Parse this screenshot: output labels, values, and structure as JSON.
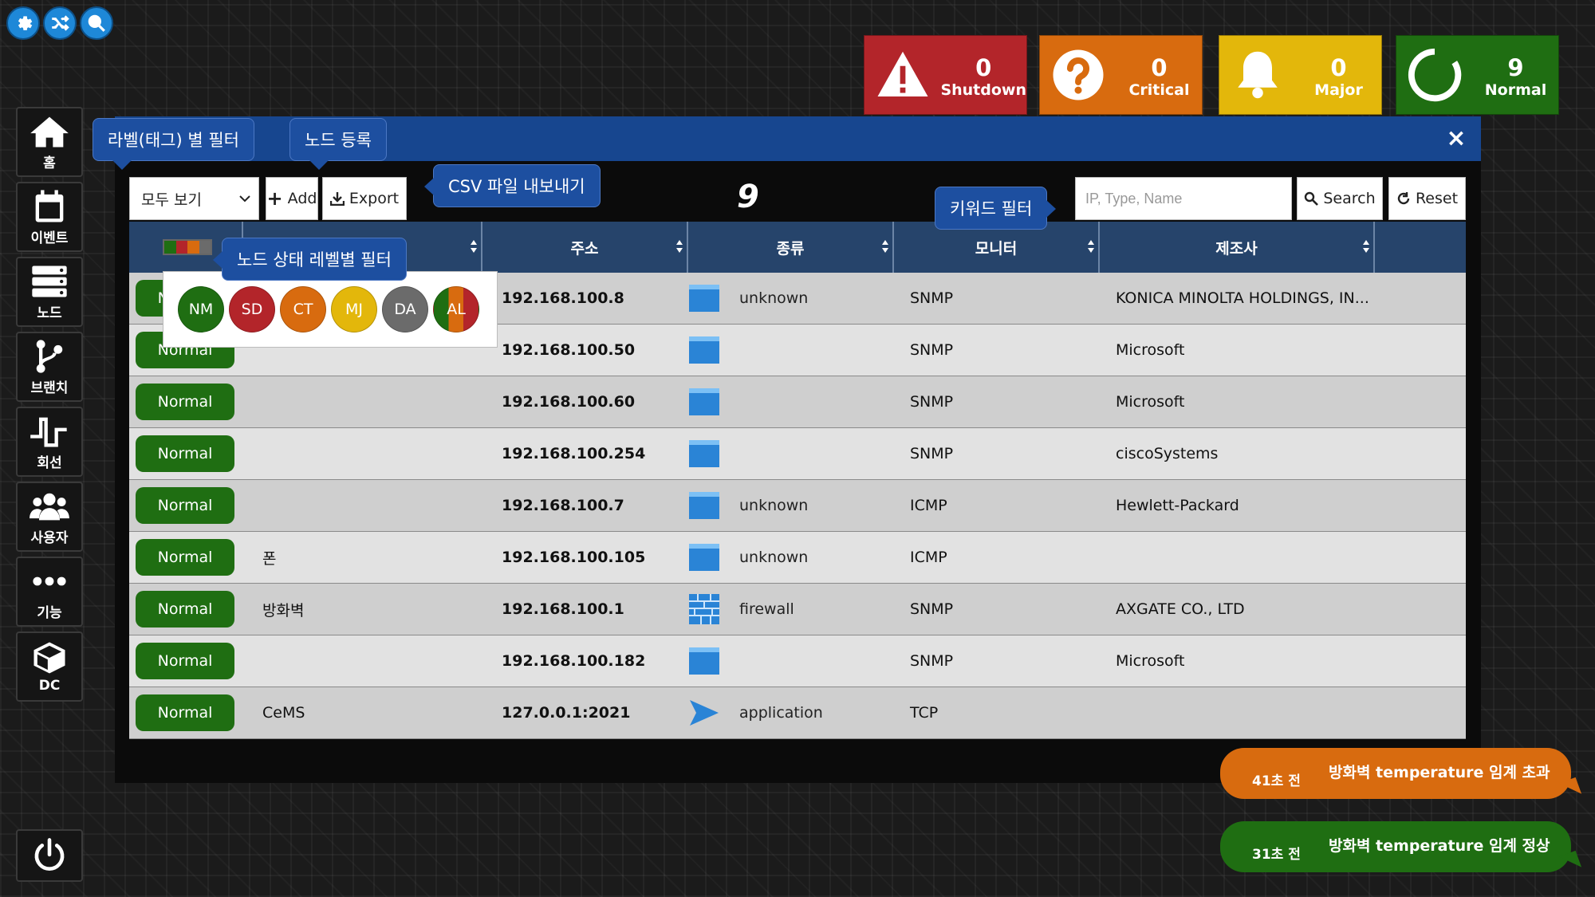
{
  "status_cards": [
    {
      "count": "0",
      "label": "Shutdown",
      "color": "#b3252a",
      "icon": "warning-icon"
    },
    {
      "count": "0",
      "label": "Critical",
      "color": "#d86b0f",
      "icon": "question-icon"
    },
    {
      "count": "0",
      "label": "Major",
      "color": "#e3b70b",
      "icon": "bell-icon"
    },
    {
      "count": "9",
      "label": "Normal",
      "color": "#1f6e12",
      "icon": "ring-icon"
    }
  ],
  "sidebar": {
    "items": [
      {
        "label": "홈"
      },
      {
        "label": "이벤트"
      },
      {
        "label": "노드"
      },
      {
        "label": "브랜치"
      },
      {
        "label": "회선"
      },
      {
        "label": "사용자"
      },
      {
        "label": "기능"
      },
      {
        "label": "DC"
      }
    ]
  },
  "toolbar": {
    "filter_selected": "모두 보기",
    "add_label": "Add",
    "export_label": "Export",
    "node_count": "9",
    "search_placeholder": "IP, Type, Name",
    "search_label": "Search",
    "reset_label": "Reset"
  },
  "tooltips": {
    "label_filter": "라벨(태그) 별 필터",
    "node_register": "노드 등록",
    "csv_export": "CSV 파일 내보내기",
    "keyword_filter": "키워드 필터",
    "status_level_filter": "노드 상태 레벨별 필터"
  },
  "table": {
    "headers": [
      "주소",
      "종류",
      "모니터",
      "제조사"
    ],
    "rows": [
      {
        "status": "Normal",
        "name": "",
        "address": "192.168.100.8",
        "type": "unknown",
        "monitor": "SNMP",
        "vendor": "KONICA MINOLTA HOLDINGS, IN..."
      },
      {
        "status": "Normal",
        "name": "",
        "address": "192.168.100.50",
        "type": "",
        "monitor": "SNMP",
        "vendor": "Microsoft"
      },
      {
        "status": "Normal",
        "name": "",
        "address": "192.168.100.60",
        "type": "",
        "monitor": "SNMP",
        "vendor": "Microsoft"
      },
      {
        "status": "Normal",
        "name": "",
        "address": "192.168.100.254",
        "type": "",
        "monitor": "SNMP",
        "vendor": "ciscoSystems"
      },
      {
        "status": "Normal",
        "name": "",
        "address": "192.168.100.7",
        "type": "unknown",
        "monitor": "ICMP",
        "vendor": "Hewlett-Packard"
      },
      {
        "status": "Normal",
        "name": "폰",
        "address": "192.168.100.105",
        "type": "unknown",
        "monitor": "ICMP",
        "vendor": ""
      },
      {
        "status": "Normal",
        "name": "방화벽",
        "address": "192.168.100.1",
        "type": "firewall",
        "monitor": "SNMP",
        "vendor": "AXGATE CO., LTD"
      },
      {
        "status": "Normal",
        "name": "",
        "address": "192.168.100.182",
        "type": "",
        "monitor": "SNMP",
        "vendor": "Microsoft"
      },
      {
        "status": "Normal",
        "name": "CeMS",
        "address": "127.0.0.1:2021",
        "type": "application",
        "monitor": "TCP",
        "vendor": ""
      }
    ]
  },
  "level_filter": [
    {
      "code": "NM",
      "color": "#1f6e12"
    },
    {
      "code": "SD",
      "color": "#b3252a"
    },
    {
      "code": "CT",
      "color": "#d86b0f"
    },
    {
      "code": "MJ",
      "color": "#e3b70b"
    },
    {
      "code": "DA",
      "color": "#6b6b6b"
    },
    {
      "code": "AL",
      "color": "#d86b0f"
    }
  ],
  "notifications": [
    {
      "time": "41초 전",
      "message": "방화벽 temperature 임계 초과",
      "color": "#d86b0f"
    },
    {
      "time": "31초 전",
      "message": "방화벽 temperature 임계 정상",
      "color": "#1f6e12"
    }
  ]
}
